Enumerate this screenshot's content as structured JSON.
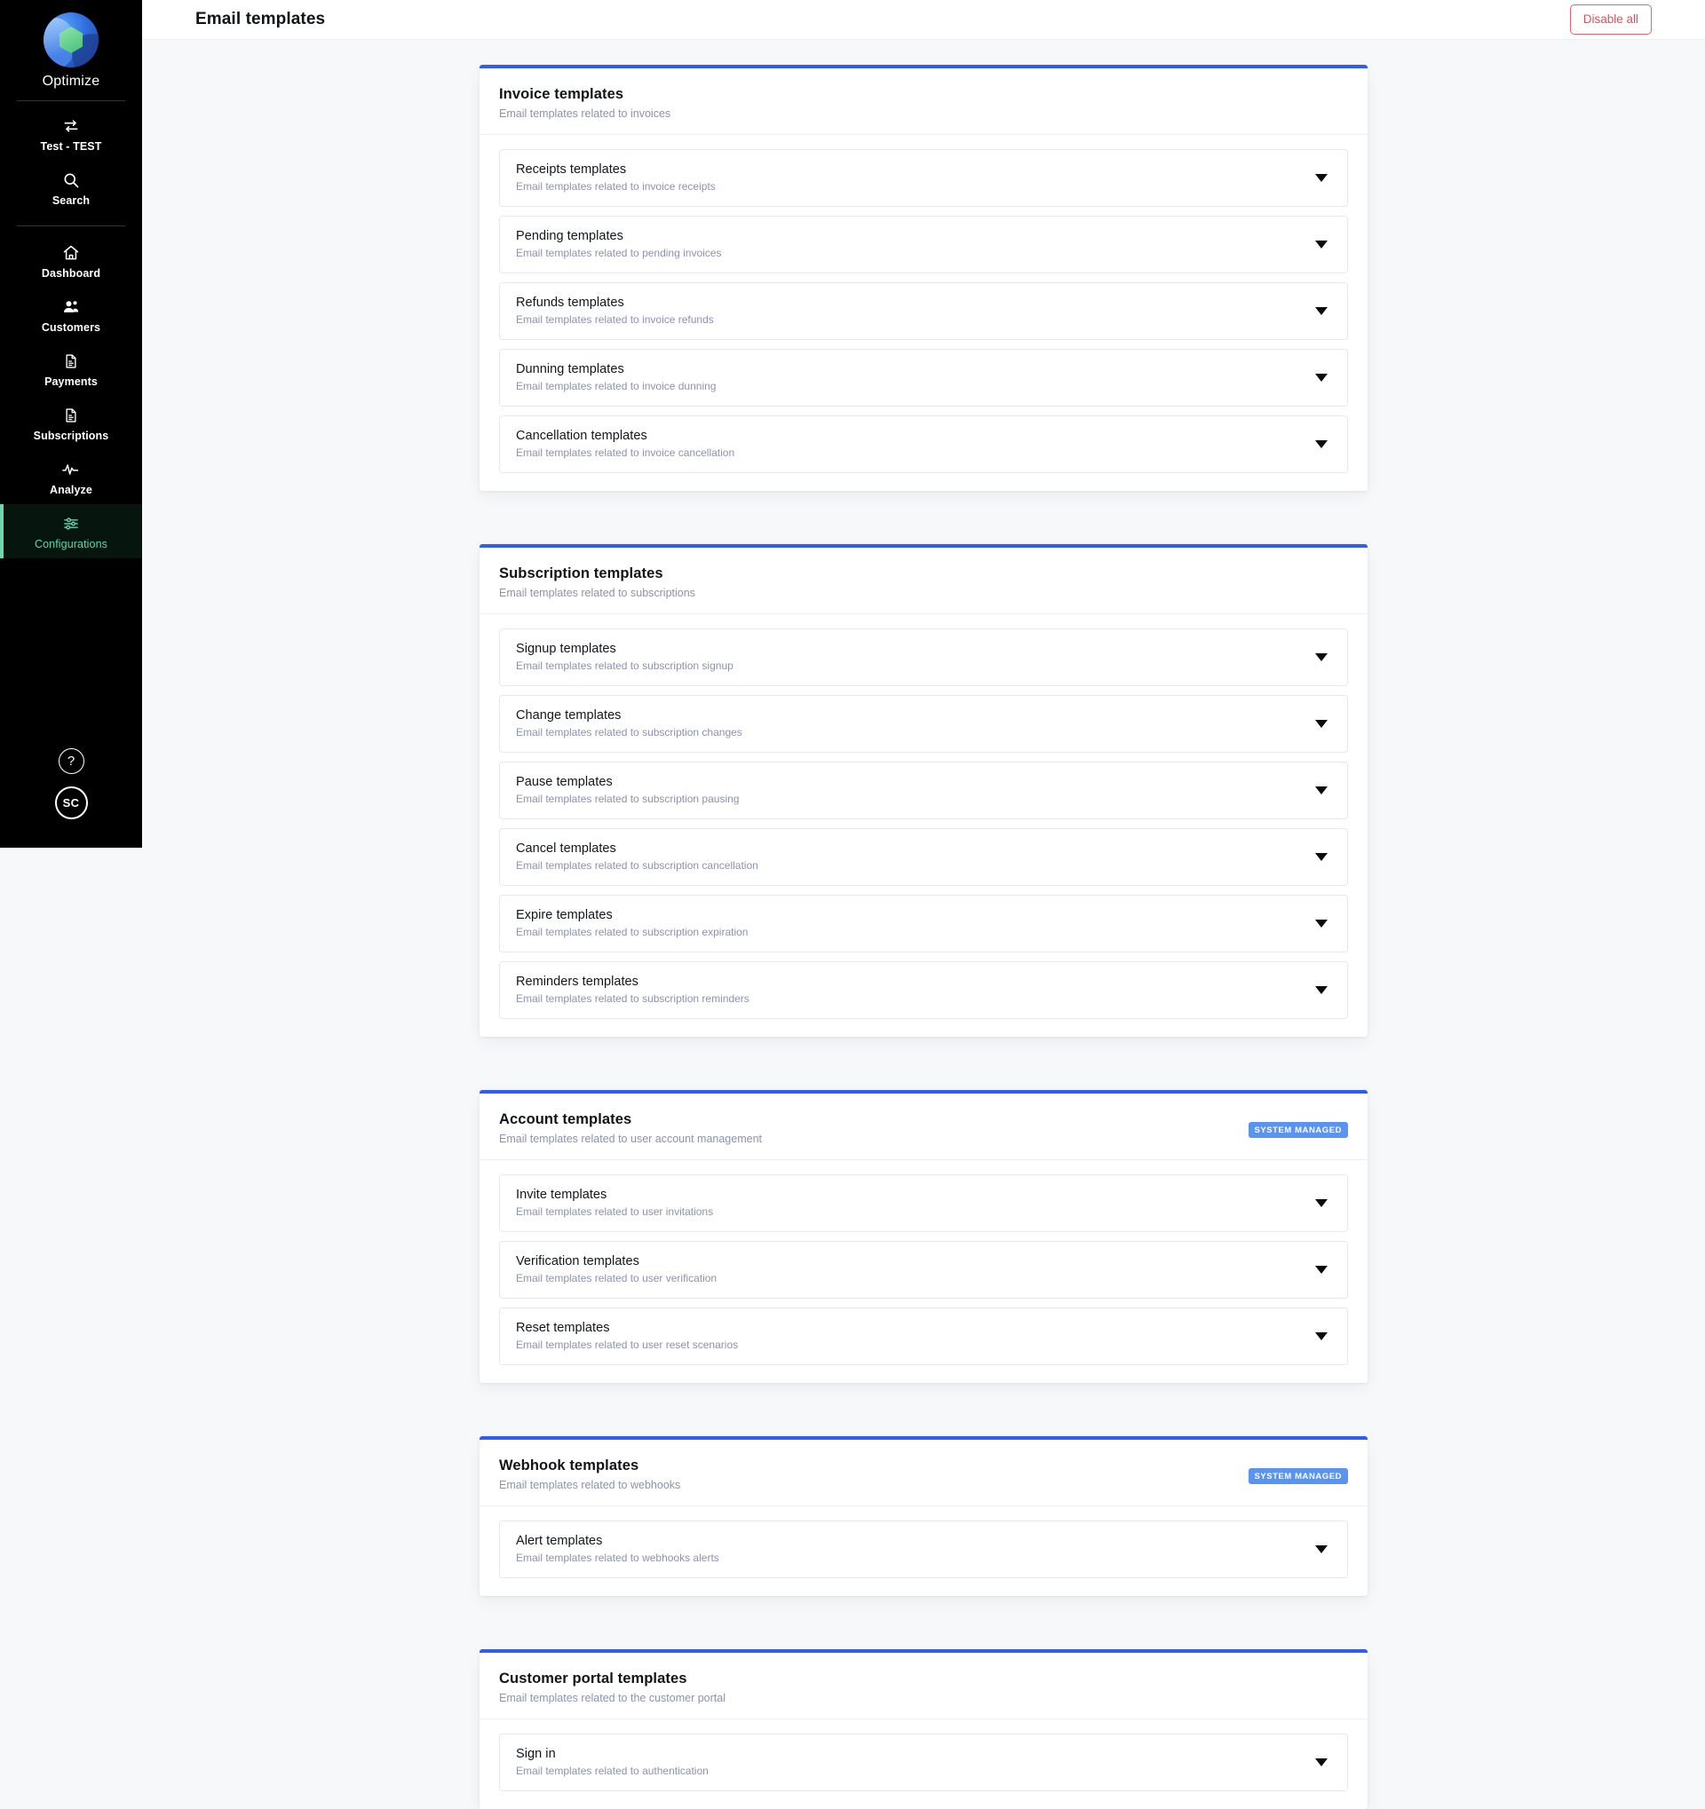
{
  "colors": {
    "accent_blue": "#2f5cf5",
    "badge_blue": "#5b93f0",
    "danger_red": "#e0505f",
    "sidebar_active_green": "#5fd6a8",
    "page_background": "#f7f8fa"
  },
  "sidebar": {
    "brand": {
      "name": "Optimize",
      "logo_icon": "optimize-logo-icon"
    },
    "top_items": [
      {
        "label": "Test - TEST",
        "icon": "switch-arrows-icon",
        "active": false
      },
      {
        "label": "Search",
        "icon": "search-icon",
        "active": false
      }
    ],
    "main_items": [
      {
        "label": "Dashboard",
        "icon": "home-icon",
        "active": false
      },
      {
        "label": "Customers",
        "icon": "users-icon",
        "active": false
      },
      {
        "label": "Payments",
        "icon": "document-payment-icon",
        "active": false
      },
      {
        "label": "Subscriptions",
        "icon": "document-subscription-icon",
        "active": false
      },
      {
        "label": "Analyze",
        "icon": "activity-pulse-icon",
        "active": false
      },
      {
        "label": "Configurations",
        "icon": "sliders-icon",
        "active": true
      }
    ],
    "bottom": {
      "help_label": "?",
      "help_icon": "question-mark-icon",
      "avatar_initials": "SC"
    }
  },
  "header": {
    "title": "Email templates",
    "disable_all_label": "Disable all"
  },
  "badges": {
    "system_managed": "SYSTEM MANAGED"
  },
  "cards": [
    {
      "title": "Invoice templates",
      "subtitle": "Email templates related to invoices",
      "system_managed": false,
      "rows": [
        {
          "title": "Receipts templates",
          "subtitle": "Email templates related to invoice receipts"
        },
        {
          "title": "Pending templates",
          "subtitle": "Email templates related to pending invoices"
        },
        {
          "title": "Refunds templates",
          "subtitle": "Email templates related to invoice refunds"
        },
        {
          "title": "Dunning templates",
          "subtitle": "Email templates related to invoice dunning"
        },
        {
          "title": "Cancellation templates",
          "subtitle": "Email templates related to invoice cancellation"
        }
      ]
    },
    {
      "title": "Subscription templates",
      "subtitle": "Email templates related to subscriptions",
      "system_managed": false,
      "rows": [
        {
          "title": "Signup templates",
          "subtitle": "Email templates related to subscription signup"
        },
        {
          "title": "Change templates",
          "subtitle": "Email templates related to subscription changes"
        },
        {
          "title": "Pause templates",
          "subtitle": "Email templates related to subscription pausing"
        },
        {
          "title": "Cancel templates",
          "subtitle": "Email templates related to subscription cancellation"
        },
        {
          "title": "Expire templates",
          "subtitle": "Email templates related to subscription expiration"
        },
        {
          "title": "Reminders templates",
          "subtitle": "Email templates related to subscription reminders"
        }
      ]
    },
    {
      "title": "Account templates",
      "subtitle": "Email templates related to user account management",
      "system_managed": true,
      "rows": [
        {
          "title": "Invite templates",
          "subtitle": "Email templates related to user invitations"
        },
        {
          "title": "Verification templates",
          "subtitle": "Email templates related to user verification"
        },
        {
          "title": "Reset templates",
          "subtitle": "Email templates related to user reset scenarios"
        }
      ]
    },
    {
      "title": "Webhook templates",
      "subtitle": "Email templates related to webhooks",
      "system_managed": true,
      "rows": [
        {
          "title": "Alert templates",
          "subtitle": "Email templates related to webhooks alerts"
        }
      ]
    },
    {
      "title": "Customer portal templates",
      "subtitle": "Email templates related to the customer portal",
      "system_managed": false,
      "rows": [
        {
          "title": "Sign in",
          "subtitle": "Email templates related to authentication"
        }
      ]
    }
  ]
}
